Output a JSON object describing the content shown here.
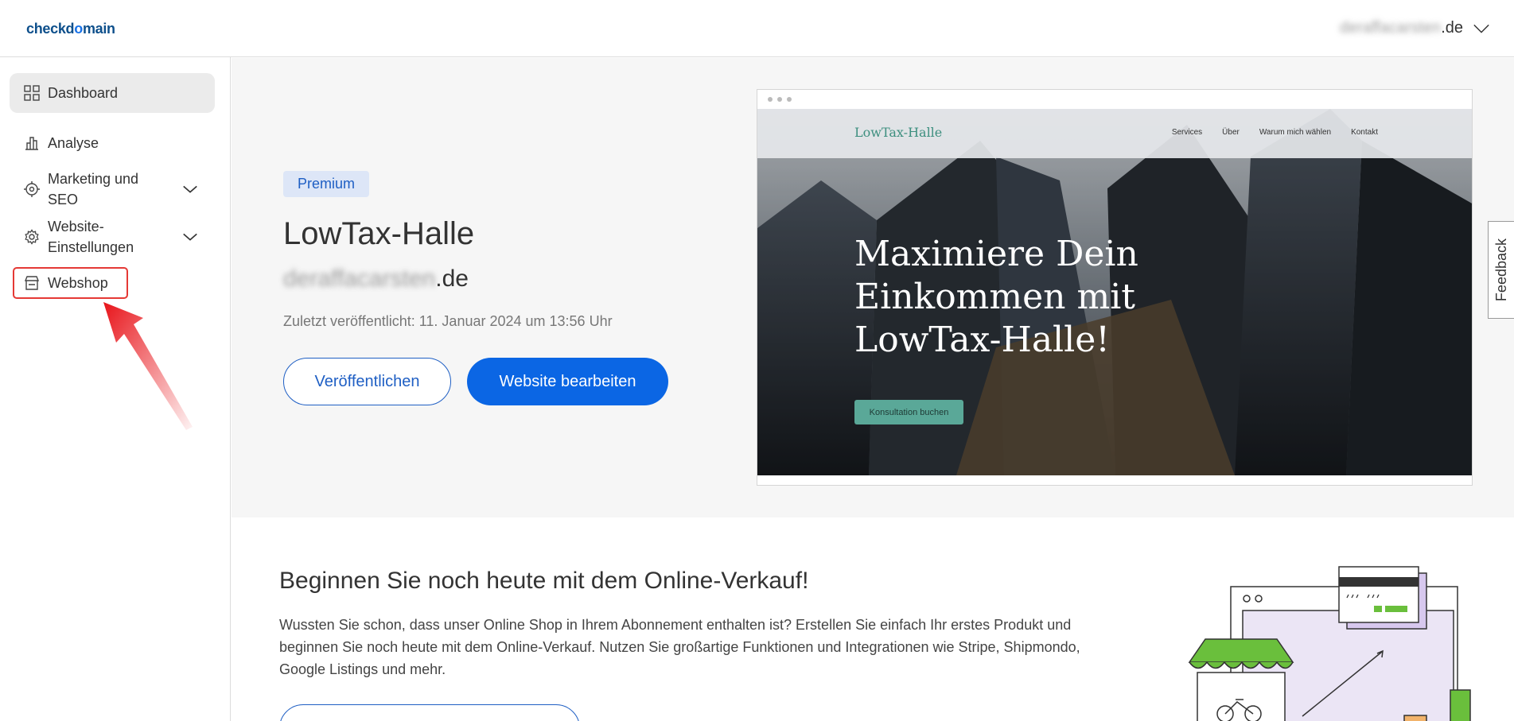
{
  "header": {
    "logo": "checkdomain",
    "domain_blurred": "deraffacarsten",
    "domain_tld": ".de"
  },
  "sidebar": {
    "items": [
      {
        "label": "Dashboard",
        "icon": "grid-icon",
        "active": true
      },
      {
        "label": "Analyse",
        "icon": "bar-chart-icon"
      },
      {
        "label": "Marketing und SEO",
        "label_line1": "Marketing und",
        "label_line2": "SEO",
        "icon": "target-icon",
        "expandable": true
      },
      {
        "label": "Website-Einstellungen",
        "label_line1": "Website-",
        "label_line2": "Einstellungen",
        "icon": "gear-icon",
        "expandable": true
      },
      {
        "label": "Webshop",
        "icon": "store-icon",
        "highlighted": true
      }
    ]
  },
  "site": {
    "badge": "Premium",
    "title": "LowTax-Halle",
    "domain_blurred": "deraffacarsten",
    "domain_tld": ".de",
    "last_published": "Zuletzt veröffentlicht: 11. Januar 2024 um 13:56 Uhr",
    "publish_button": "Veröffentlichen",
    "edit_button": "Website bearbeiten"
  },
  "preview": {
    "brand": "LowTax-Halle",
    "nav_links": [
      "Services",
      "Über",
      "Warum mich wählen",
      "Kontakt"
    ],
    "headline": "Maximiere Dein Einkommen mit LowTax-Halle!",
    "cta": "Konsultation buchen"
  },
  "feedback": {
    "label": "Feedback"
  },
  "shop": {
    "title": "Beginnen Sie noch heute mit dem Online-Verkauf!",
    "text": "Wussten Sie schon, dass unser Online Shop in Ihrem Abonnement enthalten ist? Erstellen Sie einfach Ihr erstes Produkt und beginnen Sie noch heute mit dem Online-Verkauf. Nutzen Sie großartige Funktionen und Integrationen wie Stripe, Shipmondo, Google Listings und mehr."
  },
  "colors": {
    "accent": "#0b66e4",
    "highlight": "#e53935",
    "preview_green": "#5aa898"
  }
}
